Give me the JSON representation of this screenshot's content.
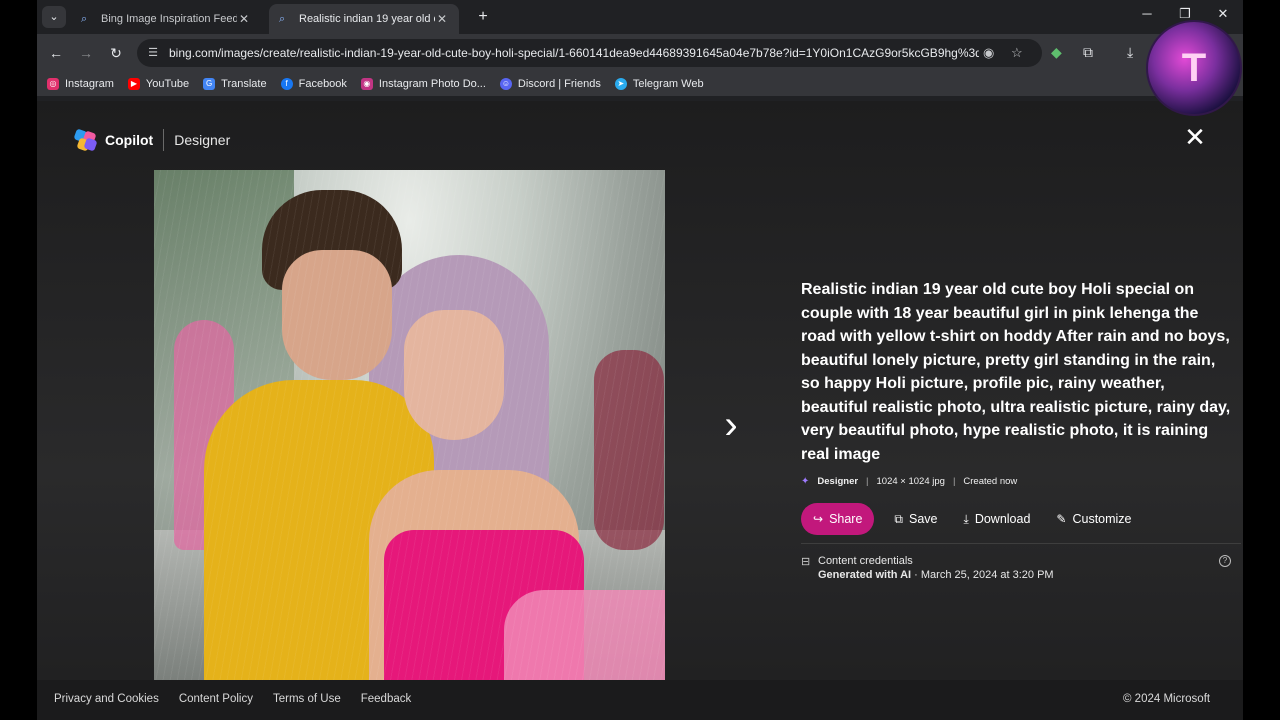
{
  "browser": {
    "tabs": [
      {
        "title": "Bing Image Inspiration Feed",
        "favicon": "search-icon"
      },
      {
        "title": "Realistic indian 19 year old cute",
        "favicon": "search-icon",
        "active": true
      }
    ],
    "new_tab": "+",
    "url": "bing.com/images/create/realistic-indian-19-year-old-cute-boy-holi-special/1-660141dea9ed44689391645a04e7b78e?id=1Y0iOn1CAzG9or5kcGB9hg%3d...",
    "bookmarks": [
      {
        "label": "Instagram",
        "color": "#e1306c"
      },
      {
        "label": "YouTube",
        "color": "#ff0000"
      },
      {
        "label": "Translate",
        "color": "#4285f4"
      },
      {
        "label": "Facebook",
        "color": "#1877f2"
      },
      {
        "label": "Instagram Photo Do...",
        "color": "#c13584"
      },
      {
        "label": "Discord | Friends",
        "color": "#5865f2"
      },
      {
        "label": "Telegram Web",
        "color": "#2aabee"
      }
    ],
    "avatar_text": "T"
  },
  "header": {
    "brand": "Copilot",
    "product": "Designer"
  },
  "details": {
    "prompt": "Realistic indian 19 year old cute boy Holi special on couple with 18 year beautiful girl in pink lehenga the road with yellow t-shirt on hoddy After rain and no boys, beautiful lonely picture, pretty girl standing in the rain, so happy Holi picture, profile pic, rainy weather, beautiful realistic photo, ultra realistic picture, rainy day, very beautiful photo, hype realistic photo, it is raining real image",
    "meta_source": "Designer",
    "meta_size": "1024 × 1024 jpg",
    "meta_created": "Created now",
    "actions": {
      "share": "Share",
      "save": "Save",
      "download": "Download",
      "customize": "Customize"
    },
    "credentials_title": "Content credentials",
    "credentials_generated": "Generated with AI",
    "credentials_date": " · March 25, 2024 at 3:20 PM"
  },
  "footer": {
    "links": [
      "Privacy and Cookies",
      "Content Policy",
      "Terms of Use",
      "Feedback"
    ],
    "copyright": "© 2024 Microsoft"
  },
  "colors": {
    "share_button": "#c2187c",
    "page_bg": "#202124",
    "accent_purple": "#9f7bff"
  }
}
